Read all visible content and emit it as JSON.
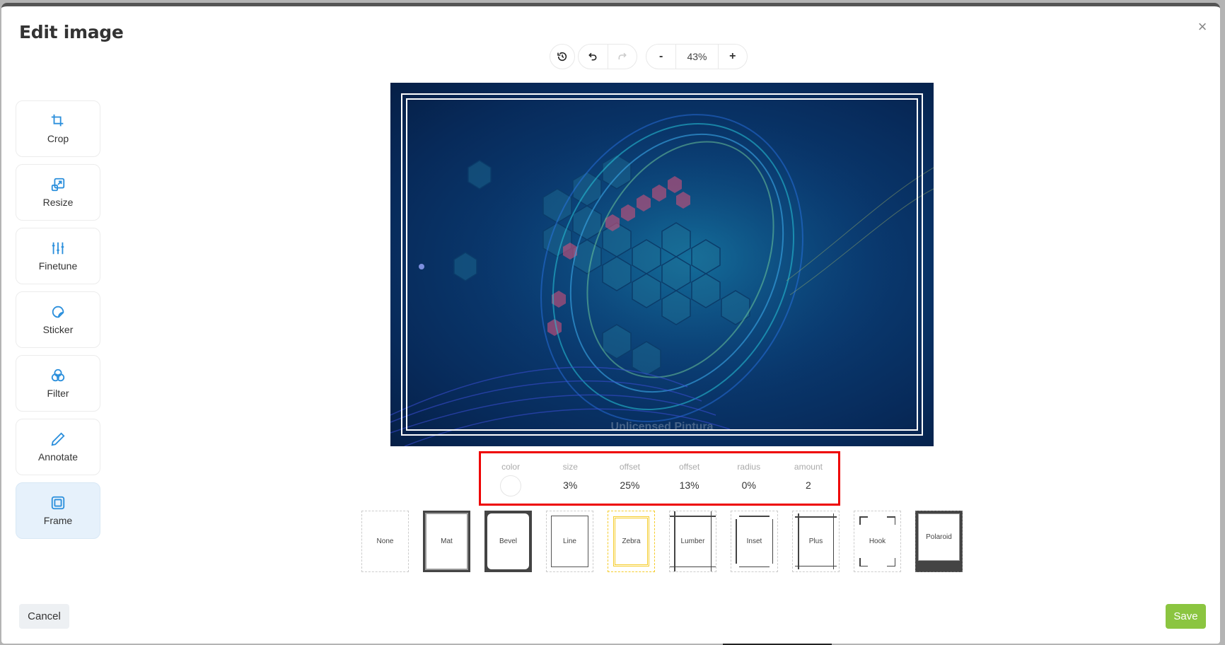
{
  "dialog": {
    "title": "Edit image",
    "close_icon": "close-icon",
    "cancel_label": "Cancel",
    "save_label": "Save",
    "accent_color": "#8bc540"
  },
  "sidebar": {
    "items": [
      {
        "label": "Crop",
        "icon": "crop-icon",
        "active": false
      },
      {
        "label": "Resize",
        "icon": "resize-icon",
        "active": false
      },
      {
        "label": "Finetune",
        "icon": "sliders-icon",
        "active": false
      },
      {
        "label": "Sticker",
        "icon": "sticker-icon",
        "active": false
      },
      {
        "label": "Filter",
        "icon": "filter-icon",
        "active": false
      },
      {
        "label": "Annotate",
        "icon": "pencil-icon",
        "active": false
      },
      {
        "label": "Frame",
        "icon": "frame-icon",
        "active": true
      }
    ]
  },
  "toolbar": {
    "revert_icon": "history-icon",
    "undo_icon": "undo-icon",
    "redo_icon": "redo-icon",
    "zoom_out_label": "-",
    "zoom_level": "43%",
    "zoom_in_label": "+"
  },
  "canvas": {
    "watermark": "Unlicensed Pintura"
  },
  "frame_properties": [
    {
      "label": "color",
      "value": "",
      "swatch": "#ffffff"
    },
    {
      "label": "size",
      "value": "3%"
    },
    {
      "label": "offset",
      "value": "25%"
    },
    {
      "label": "offset",
      "value": "13%"
    },
    {
      "label": "radius",
      "value": "0%"
    },
    {
      "label": "amount",
      "value": "2"
    }
  ],
  "frame_styles": [
    {
      "label": "None"
    },
    {
      "label": "Mat"
    },
    {
      "label": "Bevel"
    },
    {
      "label": "Line"
    },
    {
      "label": "Zebra",
      "selected": true
    },
    {
      "label": "Lumber"
    },
    {
      "label": "Inset"
    },
    {
      "label": "Plus"
    },
    {
      "label": "Hook"
    },
    {
      "label": "Polaroid"
    }
  ]
}
